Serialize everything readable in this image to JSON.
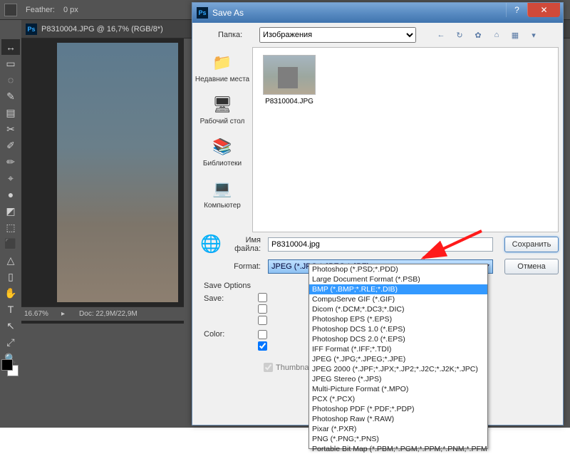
{
  "ps": {
    "optbar": {
      "feather_label": "Feather:",
      "feather_value": "0 px"
    },
    "doc_tab": "P8310004.JPG @ 16,7% (RGB/8*)",
    "tools": [
      "↔",
      "▭",
      "◌",
      "✎",
      "▤",
      "✂",
      "✐",
      "✏",
      "⌖",
      "●",
      "◩",
      "⬚",
      "⬛",
      "△",
      "▯",
      "✋",
      "T",
      "↖",
      "⤢",
      "🔍"
    ],
    "status": {
      "zoom": "16.67%",
      "doc": "Doc: 22,9M/22,9M"
    }
  },
  "dialog": {
    "title": "Save As",
    "folder_label": "Папка:",
    "folder_value": "Изображения",
    "toolbar_icons": [
      "←",
      "↻",
      "✿",
      "⌂",
      "▦",
      "▾"
    ],
    "sidebar": [
      {
        "label": "Недавние места",
        "icon": "📁"
      },
      {
        "label": "Рабочий стол",
        "icon": "🖥"
      },
      {
        "label": "Библиотеки",
        "icon": "📚"
      },
      {
        "label": "Компьютер",
        "icon": "💻"
      }
    ],
    "file_list": [
      {
        "name": "P8310004.JPG"
      }
    ],
    "filename_label": "Имя файла:",
    "filename_value": "P8310004.jpg",
    "format_label": "Format:",
    "format_value": "JPEG (*.JPG;*.JPEG;*.JPE)",
    "buttons": {
      "save": "Сохранить",
      "cancel": "Отмена"
    },
    "save_options_label": "Save Options",
    "save_label": "Save:",
    "color_label": "Color:",
    "thumbnail_label": "Thumbnail"
  },
  "format_options": [
    "Photoshop (*.PSD;*.PDD)",
    "Large Document Format (*.PSB)",
    "BMP (*.BMP;*.RLE;*.DIB)",
    "CompuServe GIF (*.GIF)",
    "Dicom (*.DCM;*.DC3;*.DIC)",
    "Photoshop EPS (*.EPS)",
    "Photoshop DCS 1.0 (*.EPS)",
    "Photoshop DCS 2.0 (*.EPS)",
    "IFF Format (*.IFF;*.TDI)",
    "JPEG (*.JPG;*.JPEG;*.JPE)",
    "JPEG 2000 (*.JPF;*.JPX;*.JP2;*.J2C;*.J2K;*.JPC)",
    "JPEG Stereo (*.JPS)",
    "Multi-Picture Format (*.MPO)",
    "PCX (*.PCX)",
    "Photoshop PDF (*.PDF;*.PDP)",
    "Photoshop Raw (*.RAW)",
    "Pixar (*.PXR)",
    "PNG (*.PNG;*.PNS)",
    "Portable Bit Map (*.PBM;*.PGM;*.PPM;*.PNM;*.PFM;*.PAM)"
  ],
  "format_selected_index": 2
}
